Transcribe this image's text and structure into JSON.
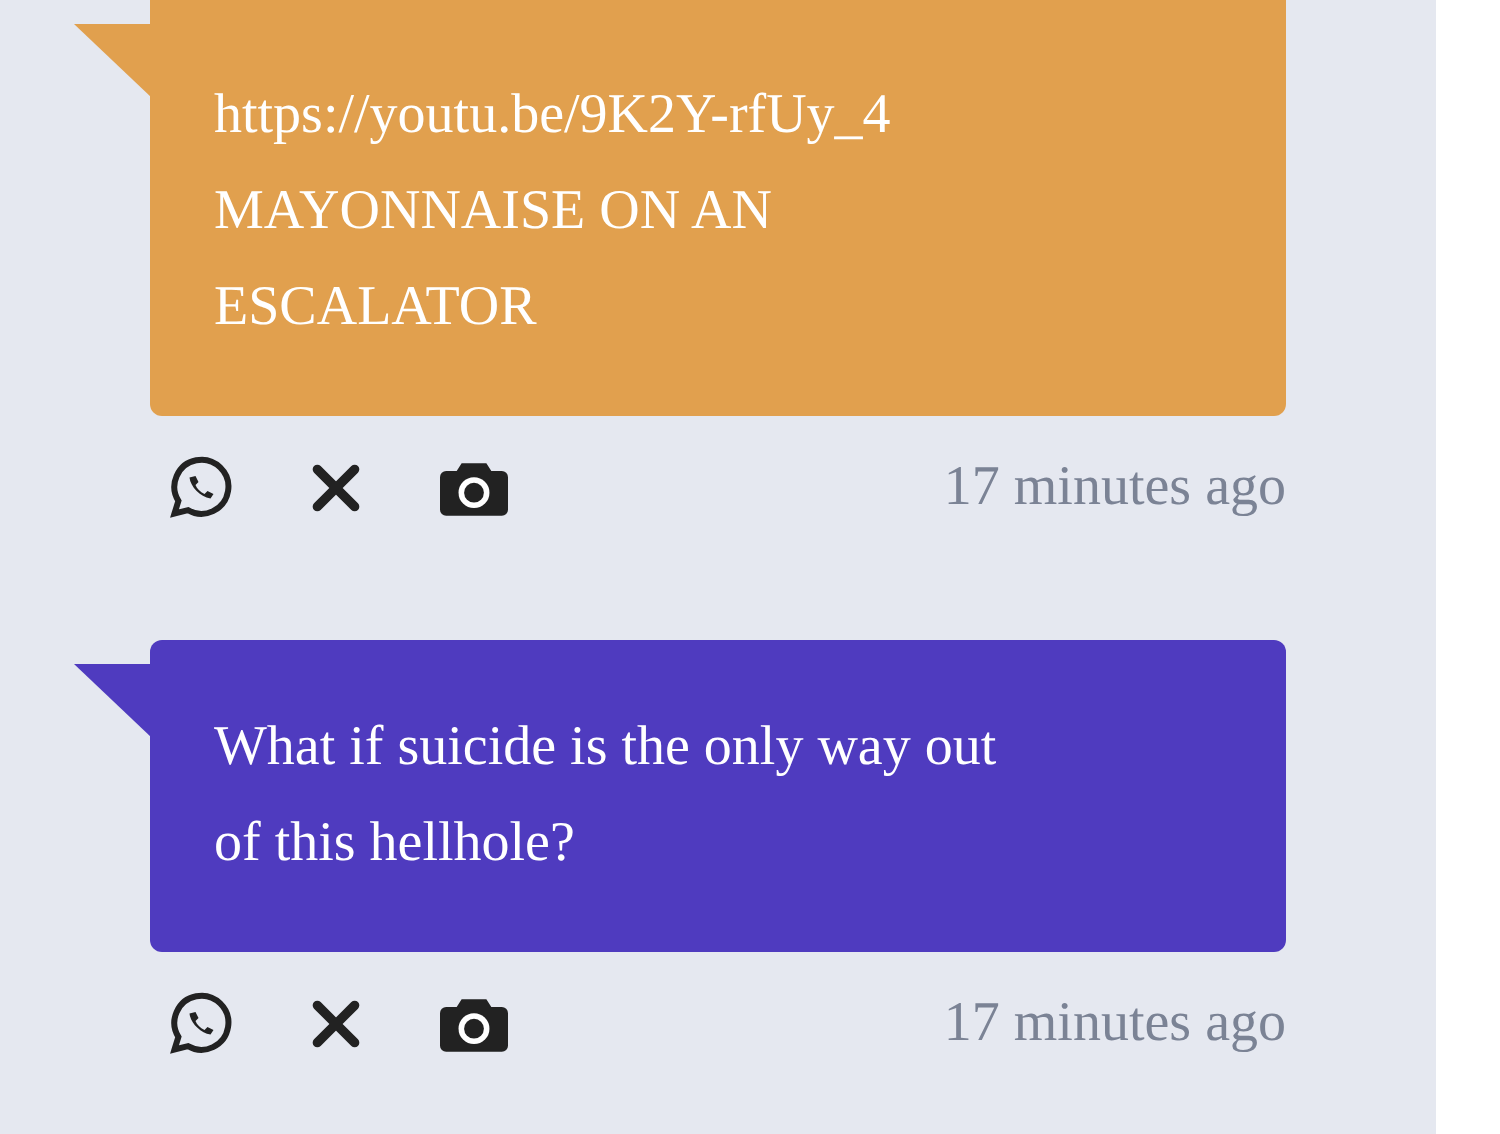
{
  "messages": [
    {
      "lines": [
        "https://youtu.be/9K2Y-rfUy_4",
        "MAYONNAISE ON AN",
        "ESCALATOR"
      ],
      "color": "#e1a04e",
      "time": "17 minutes ago"
    },
    {
      "lines": [
        "What if suicide is the only way out",
        "of this hellhole?"
      ],
      "color": "#4f3bbf",
      "time": "17 minutes ago"
    }
  ]
}
